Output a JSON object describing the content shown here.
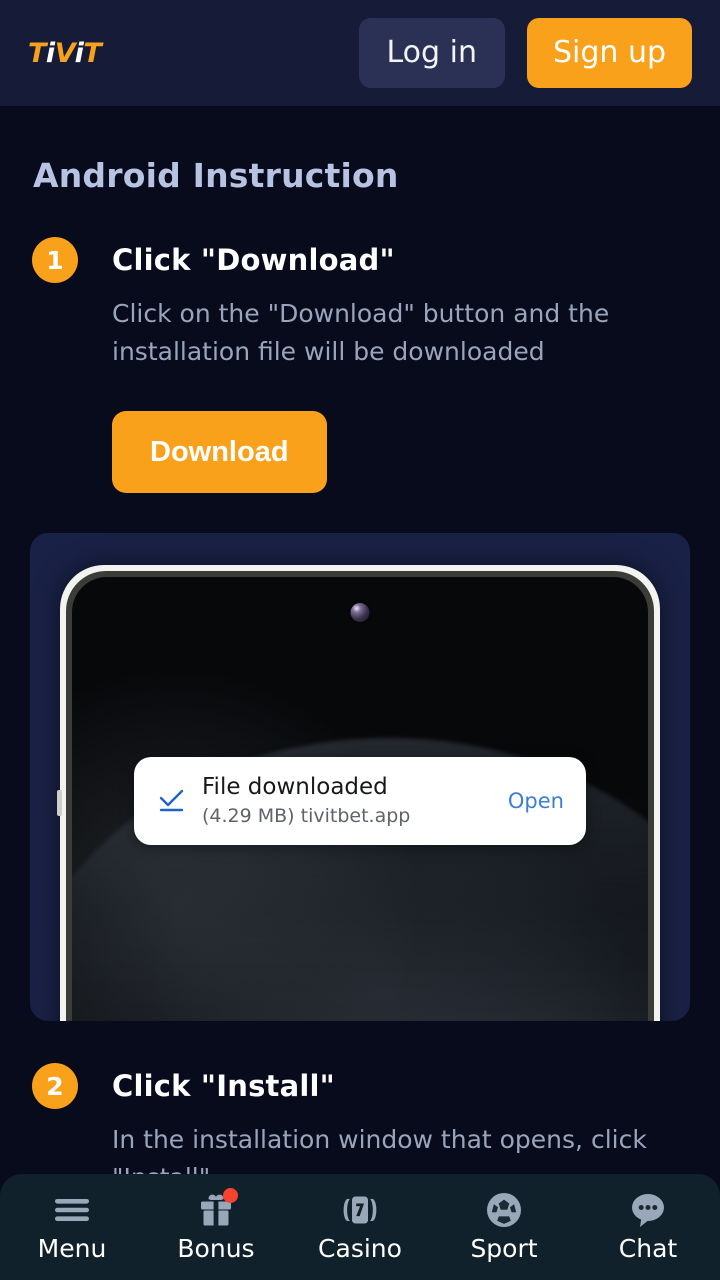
{
  "header": {
    "logo": {
      "full": "TiViT",
      "parts": [
        {
          "char": "T",
          "color": "orange"
        },
        {
          "char": "i",
          "color": "white"
        },
        {
          "char": "V",
          "color": "orange"
        },
        {
          "char": "i",
          "color": "white"
        },
        {
          "char": "T",
          "color": "orange"
        }
      ]
    },
    "login_label": "Log in",
    "signup_label": "Sign up",
    "background": "#161c38",
    "login_bg": "#2b3154",
    "signup_bg": "#f9a11b"
  },
  "main": {
    "page_title": "Android Instruction",
    "title_color": "#b6c3e2",
    "steps": [
      {
        "number": "1",
        "title": "Click \"Download\"",
        "text": "Click on the \"Download\" button and the installation file will be downloaded"
      },
      {
        "number": "2",
        "title": "Click \"Install\"",
        "text": "In the installation window that opens, click \"Install\""
      }
    ],
    "download_button_label": "Download",
    "accent_color": "#f9a11b"
  },
  "phone_mockup": {
    "card_background": "#1a2146",
    "toast": {
      "icon": "download-check-icon",
      "title": "File downloaded",
      "subtitle": "(4.29 MB) tivitbet.app",
      "file_size": "4.29 MB",
      "file_name": "tivitbet.app",
      "action_label": "Open",
      "action_color": "#3b7fd4"
    },
    "camera": "punch-hole-camera"
  },
  "bottom_nav": {
    "background": "#11212b",
    "items": [
      {
        "label": "Menu",
        "icon": "hamburger-menu-icon",
        "badge": false
      },
      {
        "label": "Bonus",
        "icon": "gift-icon",
        "badge": true
      },
      {
        "label": "Casino",
        "icon": "slot-machine-seven-icon",
        "badge": false
      },
      {
        "label": "Sport",
        "icon": "soccer-ball-icon",
        "badge": false
      },
      {
        "label": "Chat",
        "icon": "chat-bubble-icon",
        "badge": false
      }
    ],
    "badge_color": "#f4442e"
  }
}
